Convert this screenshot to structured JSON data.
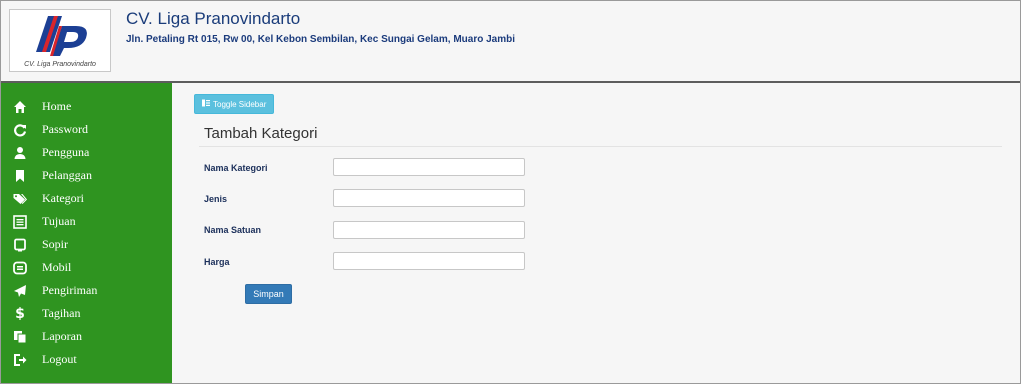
{
  "header": {
    "company_name": "CV. Liga Pranovindarto",
    "address": "Jln. Petaling Rt 015, Rw 00, Kel Kebon Sembilan, Kec Sungai Gelam, Muaro Jambi",
    "logo_caption": "CV. Liga Pranovindarto",
    "logo_letters": "LP",
    "colors": {
      "logo_blue": "#1c3f94",
      "logo_red": "#d9252b"
    }
  },
  "sidebar": {
    "bg_color": "#2f9420",
    "items": [
      {
        "label": "Home",
        "icon": "home-icon"
      },
      {
        "label": "Password",
        "icon": "refresh-icon"
      },
      {
        "label": "Pengguna",
        "icon": "user-icon"
      },
      {
        "label": "Pelanggan",
        "icon": "bookmark-icon"
      },
      {
        "label": "Kategori",
        "icon": "tags-icon"
      },
      {
        "label": "Tujuan",
        "icon": "list-alt-icon"
      },
      {
        "label": "Sopir",
        "icon": "phone-icon"
      },
      {
        "label": "Mobil",
        "icon": "modal-window-icon"
      },
      {
        "label": "Pengiriman",
        "icon": "send-icon"
      },
      {
        "label": "Tagihan",
        "icon": "dollar-icon"
      },
      {
        "label": "Laporan",
        "icon": "duplicate-icon"
      },
      {
        "label": "Logout",
        "icon": "log-out-icon"
      }
    ]
  },
  "main": {
    "toggle_label": "Toggle Sidebar",
    "page_title": "Tambah Kategori",
    "form": {
      "fields": [
        {
          "label": "Nama Kategori",
          "value": "",
          "placeholder": ""
        },
        {
          "label": "Jenis",
          "value": "",
          "placeholder": ""
        },
        {
          "label": "Nama Satuan",
          "value": "",
          "placeholder": ""
        },
        {
          "label": "Harga",
          "value": "",
          "placeholder": ""
        }
      ],
      "submit_label": "Simpan"
    }
  }
}
